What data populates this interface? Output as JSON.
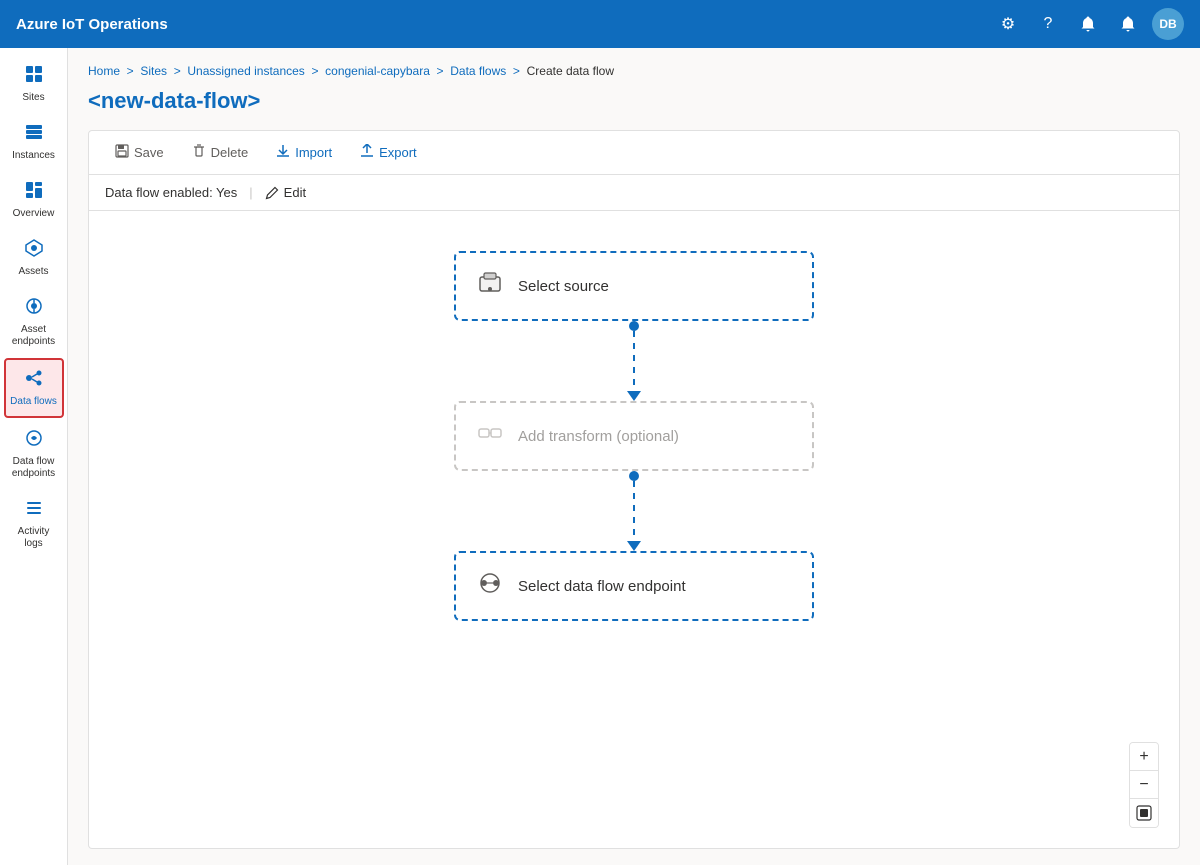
{
  "topbar": {
    "title": "Azure IoT Operations",
    "icons": {
      "settings": "⚙",
      "help": "?",
      "notification_alert": "🔔",
      "notification_bell": "🔔",
      "avatar_initials": "DB"
    }
  },
  "sidebar": {
    "items": [
      {
        "id": "sites",
        "label": "Sites",
        "icon": "⊞"
      },
      {
        "id": "instances",
        "label": "Instances",
        "icon": "⊟"
      },
      {
        "id": "overview",
        "label": "Overview",
        "icon": "▦"
      },
      {
        "id": "assets",
        "label": "Assets",
        "icon": "◈"
      },
      {
        "id": "asset-endpoints",
        "label": "Asset endpoints",
        "icon": "◎"
      },
      {
        "id": "data-flows",
        "label": "Data flows",
        "icon": "✦",
        "active": true
      },
      {
        "id": "data-flow-endpoints",
        "label": "Data flow endpoints",
        "icon": "⌁"
      },
      {
        "id": "activity-logs",
        "label": "Activity logs",
        "icon": "≡"
      }
    ]
  },
  "breadcrumb": {
    "parts": [
      "Home",
      "Sites",
      "Unassigned instances",
      "congenial-capybara",
      "Data flows",
      "Create data flow"
    ]
  },
  "page": {
    "title": "<new-data-flow>"
  },
  "toolbar": {
    "save_label": "Save",
    "delete_label": "Delete",
    "import_label": "Import",
    "export_label": "Export"
  },
  "status": {
    "label": "Data flow enabled: Yes",
    "edit_label": "Edit"
  },
  "flow": {
    "nodes": [
      {
        "id": "source",
        "label": "Select source",
        "icon": "📦",
        "optional": false
      },
      {
        "id": "transform",
        "label": "Add transform (optional)",
        "icon": "⇄",
        "optional": true
      },
      {
        "id": "endpoint",
        "label": "Select data flow endpoint",
        "icon": "⛓",
        "optional": false
      }
    ]
  },
  "zoom": {
    "plus_label": "+",
    "minus_label": "−",
    "reset_label": "⊡"
  }
}
